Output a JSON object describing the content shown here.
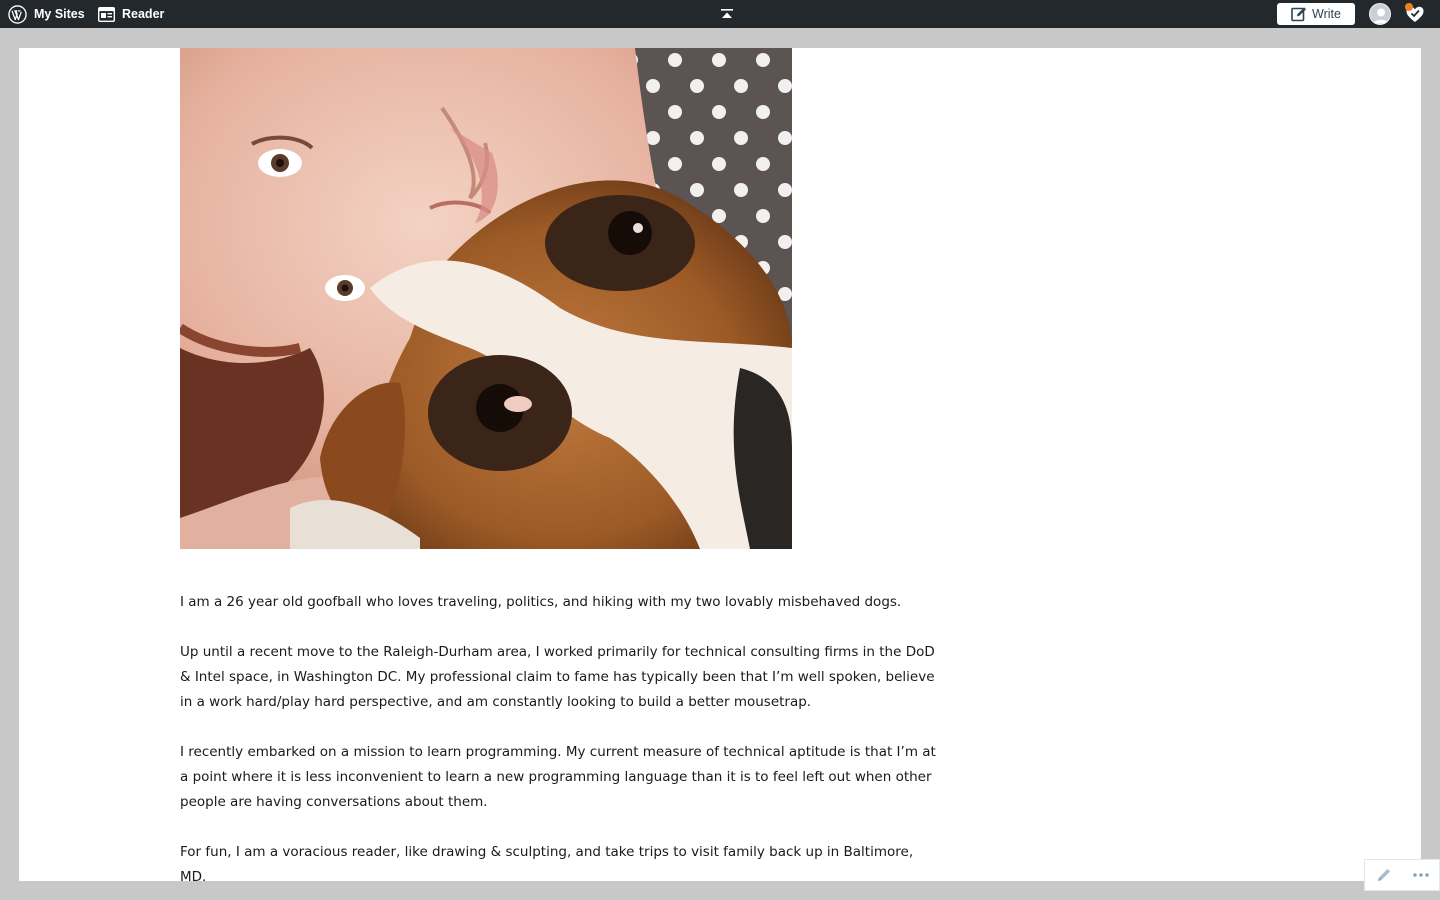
{
  "adminbar": {
    "my_sites_label": "My Sites",
    "reader_label": "Reader",
    "write_label": "Write",
    "bg_color": "#23282d",
    "notification_color": "#f0821e",
    "icons": {
      "wordpress": "wordpress-logo-icon",
      "reader": "reader-icon",
      "collapse": "collapse-up-icon",
      "write": "write-pencil-icon",
      "avatar": "user-avatar-icon",
      "notifications": "notifications-heart-icon"
    }
  },
  "page": {
    "image": {
      "alt_subject": "selfie-with-beagle-photo"
    },
    "paragraphs": [
      "I am a 26 year old goofball who loves traveling, politics, and hiking with my two lovably misbehaved dogs.",
      "Up until a recent move to the Raleigh-Durham area, I worked primarily for technical consulting firms in the DoD & Intel space, in Washington DC. My professional claim to fame has typically been that I’m well spoken, believe in a work hard/play hard perspective, and am constantly looking to build a better mousetrap.",
      "I recently embarked on a mission to learn programming. My current measure of technical aptitude is that I’m at a point where it is less inconvenient to learn a new programming language than it is to feel left out when other people are having conversations about them.",
      "For fun, I am a voracious reader, like drawing & sculpting, and take trips to visit family back up in Baltimore, MD."
    ]
  },
  "tools": {
    "icons": {
      "edit": "edit-pencil-icon",
      "more": "more-ellipsis-icon"
    }
  }
}
